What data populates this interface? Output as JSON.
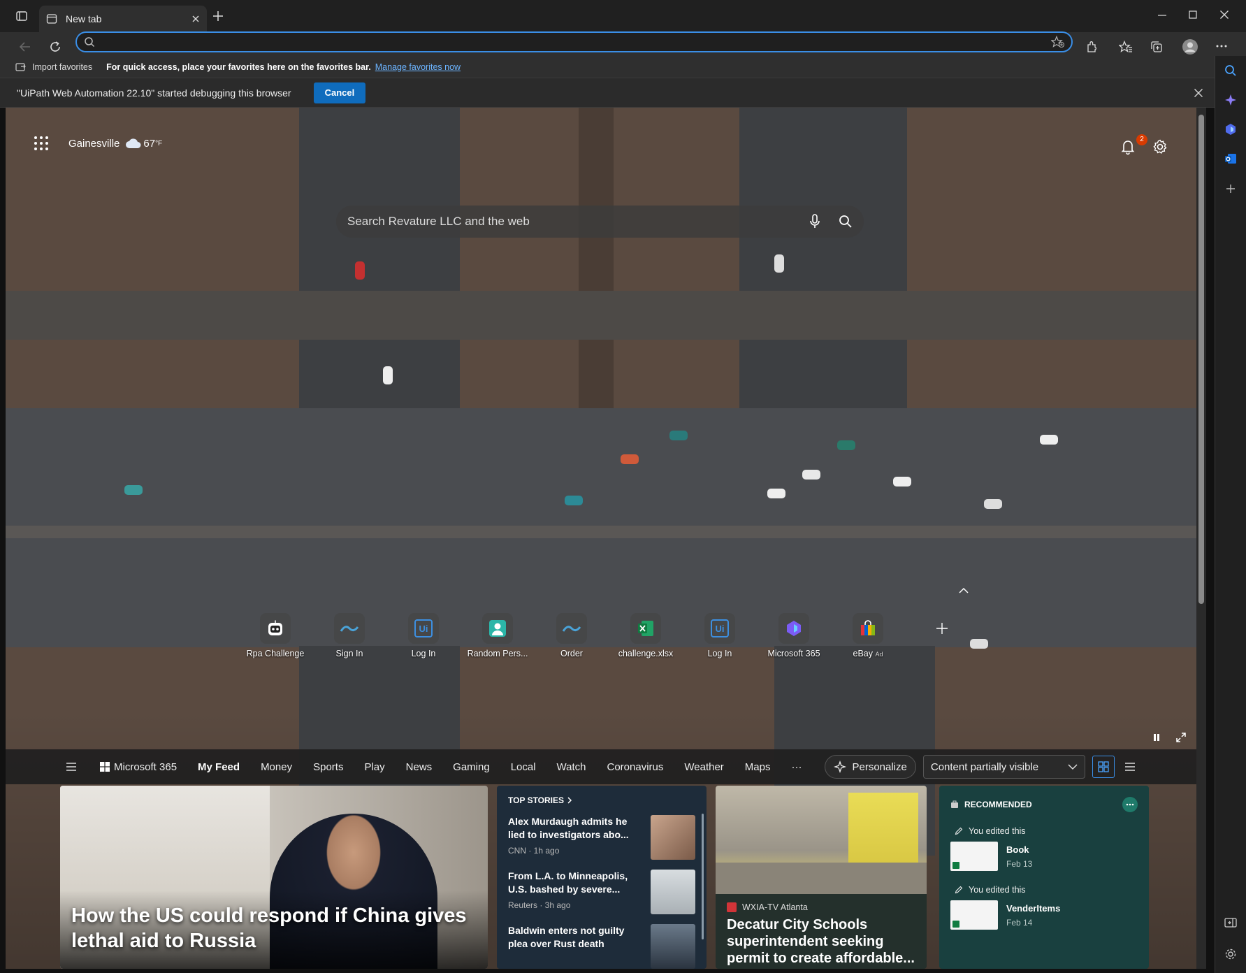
{
  "browser": {
    "tab_title": "New tab",
    "address_value": "",
    "favorites_bar": {
      "import_label": "Import favorites",
      "hint": "For quick access, place your favorites here on the favorites bar.",
      "manage_link": "Manage favorites now"
    },
    "infobar": {
      "message": "\"UiPath Web Automation 22.10\" started debugging this browser",
      "cancel_label": "Cancel"
    },
    "accent": "#0f6cbd"
  },
  "newtab": {
    "location": "Gainesville",
    "temperature": "67",
    "temp_unit": "°F",
    "notification_count": "2",
    "search_placeholder": "Search Revature LLC and the web",
    "quick_links": [
      {
        "label": "Rpa Challenge",
        "icon": "robot-icon"
      },
      {
        "label": "Sign In",
        "icon": "wave-icon"
      },
      {
        "label": "Log In",
        "icon": "uipath-icon"
      },
      {
        "label": "Random Pers...",
        "icon": "person-icon"
      },
      {
        "label": "Order",
        "icon": "wave-icon"
      },
      {
        "label": "challenge.xlsx",
        "icon": "excel-icon"
      },
      {
        "label": "Log In",
        "icon": "uipath-icon"
      },
      {
        "label": "Microsoft 365",
        "icon": "m365-icon"
      },
      {
        "label": "eBay",
        "icon": "shopping-bag-icon",
        "badge": "Ad"
      }
    ],
    "nav": {
      "m365": "Microsoft 365",
      "items": [
        "My Feed",
        "Money",
        "Sports",
        "Play",
        "News",
        "Gaming",
        "Local",
        "Watch",
        "Coronavirus",
        "Weather",
        "Maps"
      ],
      "more": "···",
      "personalize": "Personalize",
      "visibility": "Content partially visible"
    },
    "hero": {
      "title": "How the US could respond if China gives lethal aid to Russia"
    },
    "top_stories": {
      "header": "TOP STORIES",
      "items": [
        {
          "title": "Alex Murdaugh admits he lied to investigators abo...",
          "source": "CNN · 1h ago"
        },
        {
          "title": "From L.A. to Minneapolis, U.S. bashed by severe...",
          "source": "Reuters · 3h ago"
        },
        {
          "title": "Baldwin enters not guilty plea over Rust death",
          "source": ""
        }
      ]
    },
    "story_card": {
      "source": "WXIA-TV Atlanta",
      "title": "Decatur City Schools superintendent seeking permit to create affordable..."
    },
    "recommended": {
      "header": "RECOMMENDED",
      "items": [
        {
          "action": "You edited this",
          "name": "Book",
          "date": "Feb 13"
        },
        {
          "action": "You edited this",
          "name": "VenderItems",
          "date": "Feb 14"
        }
      ]
    }
  }
}
